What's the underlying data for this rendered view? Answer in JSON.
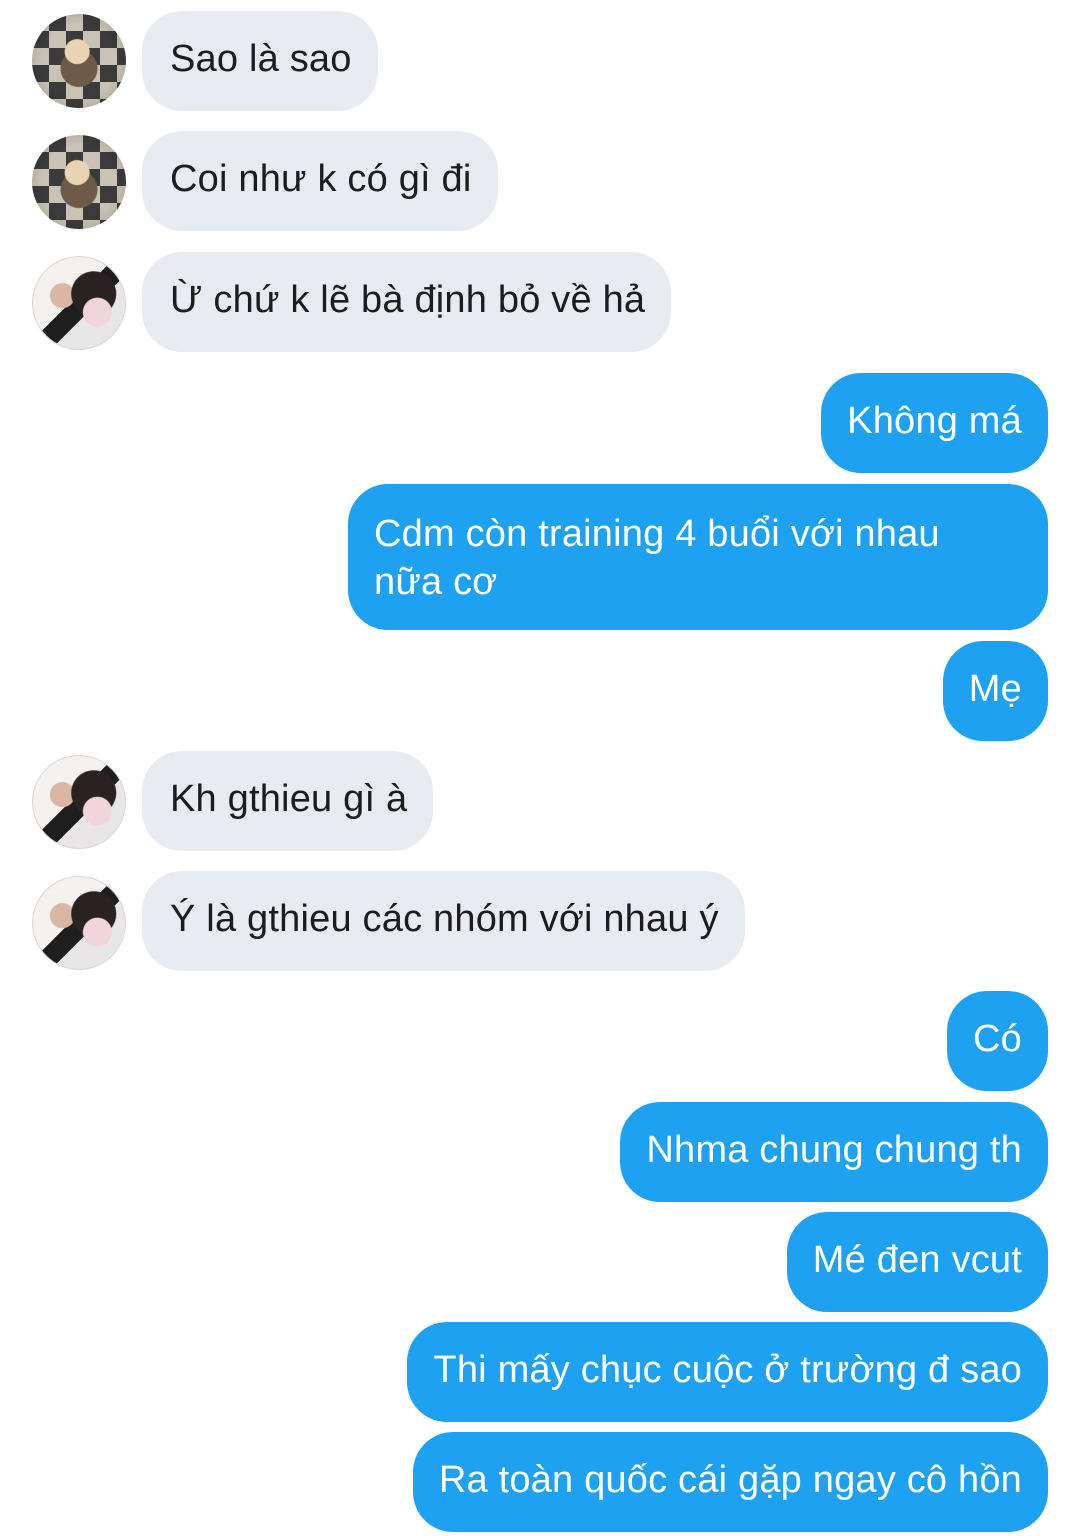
{
  "colors": {
    "incoming_bubble": "#e8ebef",
    "outgoing_bubble": "#1fa1f2",
    "incoming_text": "#1c1c1c",
    "outgoing_text": "#ffffff"
  },
  "messages": [
    {
      "from": "them",
      "avatar": "user-photo-1",
      "text": "Sao là sao"
    },
    {
      "from": "them",
      "avatar": "user-photo-1",
      "text": "Coi như k có gì đi"
    },
    {
      "from": "them",
      "avatar": "user-photo-2",
      "text": "Ừ chứ k lẽ bà định bỏ về hả"
    },
    {
      "from": "me",
      "text": "Không má"
    },
    {
      "from": "me",
      "text": "Cdm còn training 4 buổi với nhau\nnữa cơ"
    },
    {
      "from": "me",
      "text": "Mẹ"
    },
    {
      "from": "them",
      "avatar": "user-photo-2",
      "text": "Kh gthieu gì à"
    },
    {
      "from": "them",
      "avatar": "user-photo-2",
      "text": "Ý là gthieu các nhóm với nhau ý"
    },
    {
      "from": "me",
      "text": "Có"
    },
    {
      "from": "me",
      "text": "Nhma chung chung th"
    },
    {
      "from": "me",
      "text": "Mé đen vcut"
    },
    {
      "from": "me",
      "text": "Thi mấy chục cuộc ở trường đ sao"
    },
    {
      "from": "me",
      "text": "Ra toàn quốc cái gặp ngay cô hồn"
    }
  ]
}
